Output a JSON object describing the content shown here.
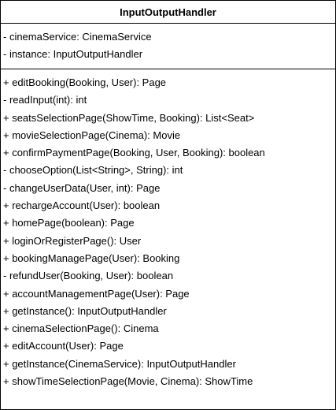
{
  "class_diagram": {
    "class_name": "InputOutputHandler",
    "attributes": [
      "- cinemaService: CinemaService",
      "- instance: InputOutputHandler"
    ],
    "methods": [
      "+ editBooking(Booking, User): Page",
      "- readInput(int): int",
      "+ seatsSelectionPage(ShowTime, Booking): List<Seat>",
      "+ movieSelectionPage(Cinema): Movie",
      "+ confirmPaymentPage(Booking, User, Booking): boolean",
      "- chooseOption(List<String>, String): int",
      "- changeUserData(User, int): Page",
      "+ rechargeAccount(User): boolean",
      "+ homePage(boolean): Page",
      "+ loginOrRegisterPage(): User",
      "+ bookingManagePage(User): Booking",
      "- refundUser(Booking, User): boolean",
      "+ accountManagementPage(User): Page",
      "+ getInstance(): InputOutputHandler",
      "+ cinemaSelectionPage(): Cinema",
      "+ editAccount(User): Page",
      "+ getInstance(CinemaService): InputOutputHandler",
      "+ showTimeSelectionPage(Movie, Cinema): ShowTime"
    ]
  }
}
